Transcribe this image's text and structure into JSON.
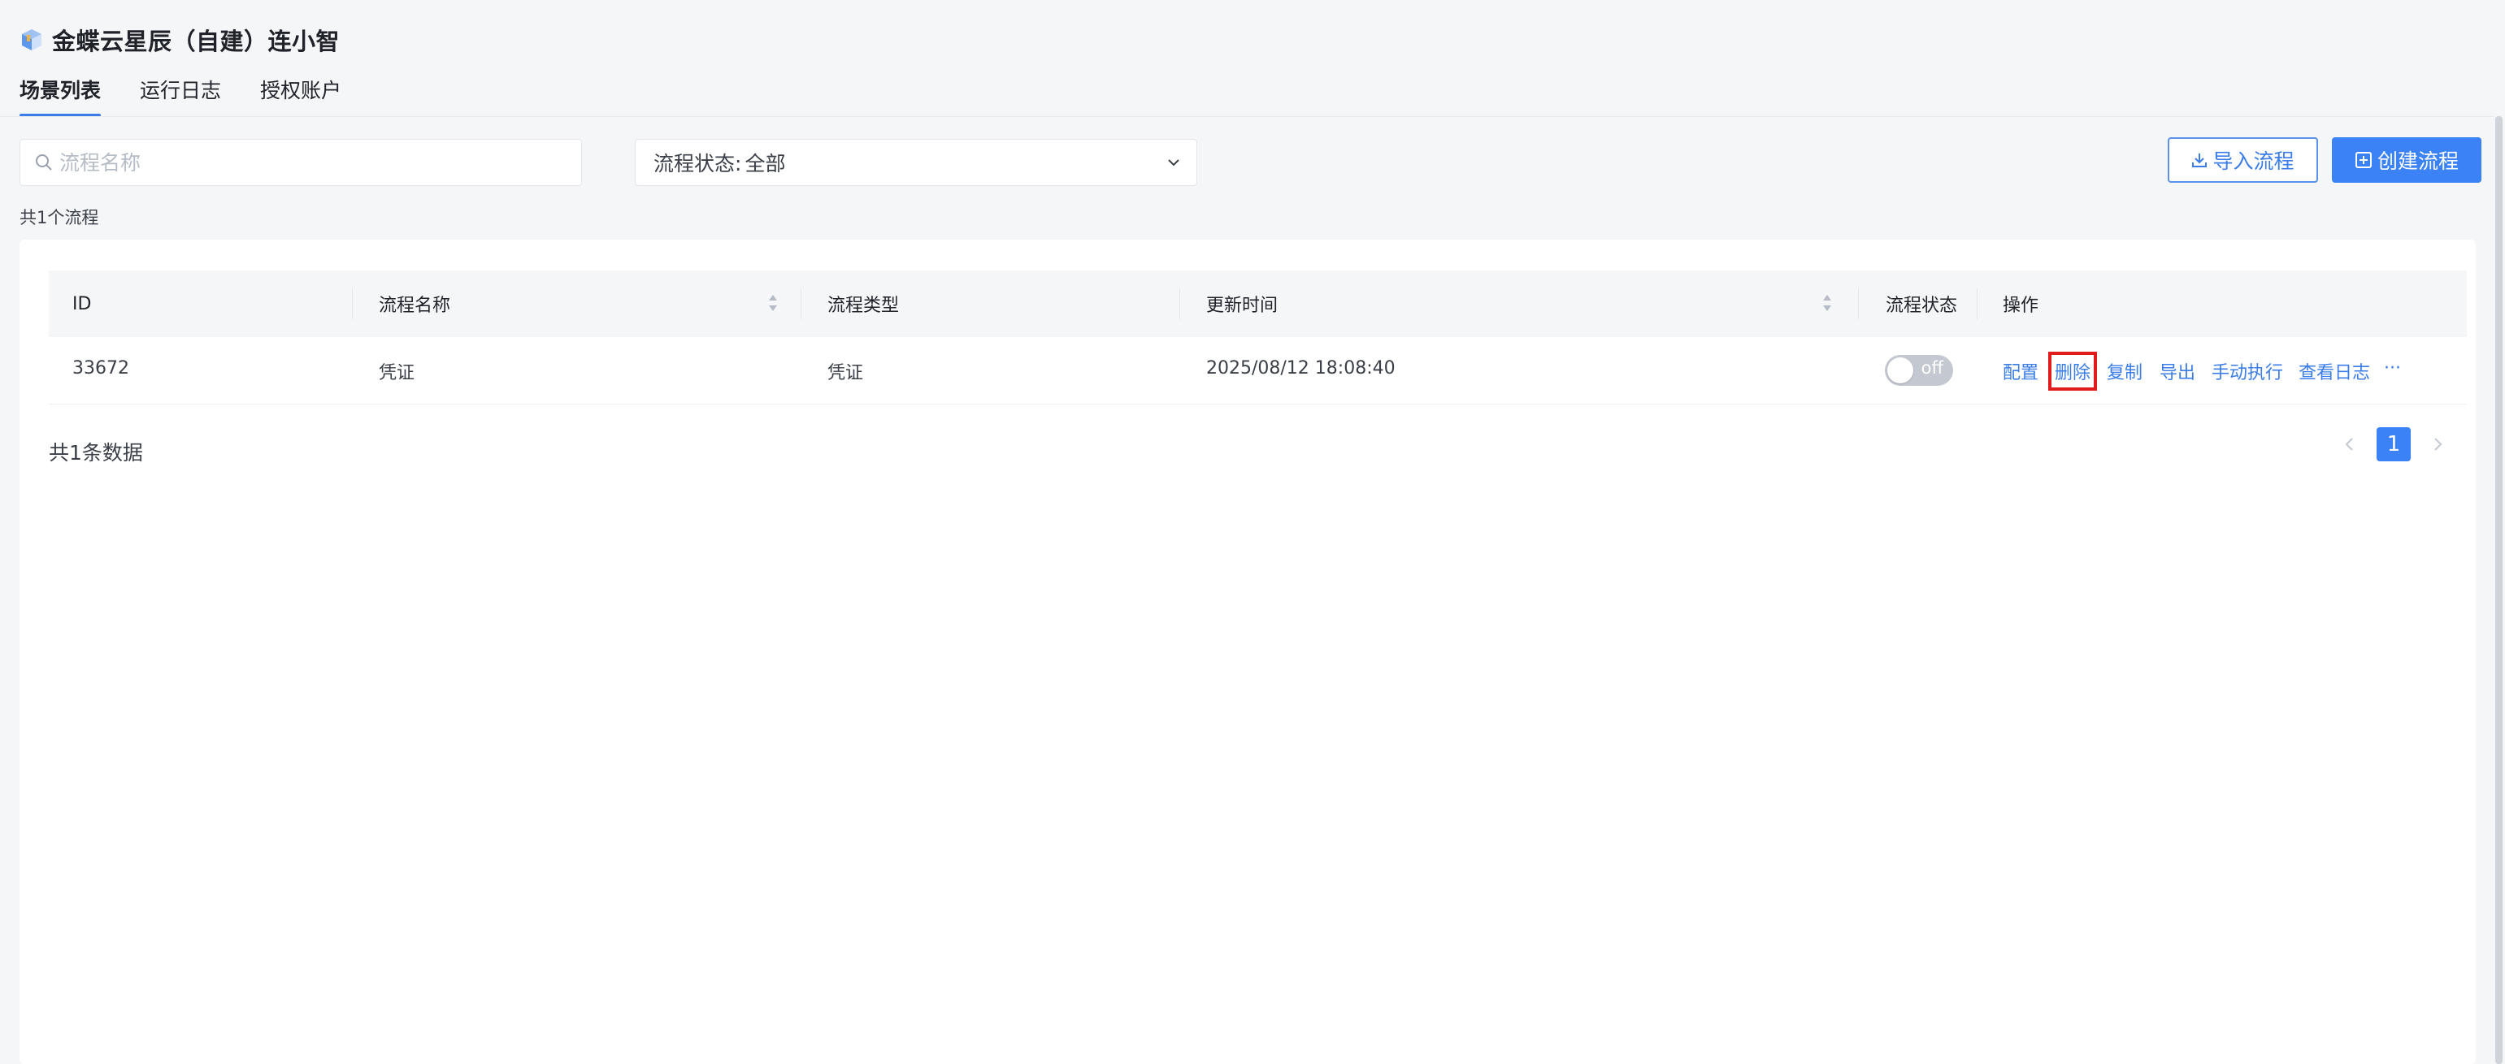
{
  "header": {
    "title": "金蝶云星辰（自建）连小智",
    "logo_icon": "cube-logo-icon"
  },
  "tabs": [
    {
      "label": "场景列表",
      "active": true
    },
    {
      "label": "运行日志",
      "active": false
    },
    {
      "label": "授权账户",
      "active": false
    }
  ],
  "toolbar": {
    "search": {
      "placeholder": "流程名称",
      "value": "",
      "icon": "search-icon"
    },
    "status_filter": {
      "label": "流程状态:",
      "value": "全部",
      "icon": "chevron-down-icon"
    },
    "import_button": {
      "label": "导入流程",
      "icon": "download-icon"
    },
    "create_button": {
      "label": "创建流程",
      "icon": "plus-square-icon"
    },
    "count_text": "共1个流程"
  },
  "table": {
    "columns": [
      {
        "label": "ID",
        "sortable": false
      },
      {
        "label": "流程名称",
        "sortable": true
      },
      {
        "label": "流程类型",
        "sortable": false
      },
      {
        "label": "更新时间",
        "sortable": true
      },
      {
        "label": "流程状态",
        "sortable": false
      },
      {
        "label": "操作",
        "sortable": false
      }
    ],
    "rows": [
      {
        "id": "33672",
        "name": "凭证",
        "type": "凭证",
        "updated": "2025/08/12 18:08:40",
        "status": {
          "on": false,
          "text": "off"
        },
        "actions": [
          "配置",
          "删除",
          "复制",
          "导出",
          "手动执行",
          "查看日志"
        ],
        "more": "···"
      }
    ]
  },
  "footer": {
    "total_text": "共1条数据",
    "current_page": "1"
  },
  "colors": {
    "accent": "#3a82f6",
    "link": "#3a7de8",
    "highlight": "#e01b1b",
    "background": "#f5f6f8"
  }
}
